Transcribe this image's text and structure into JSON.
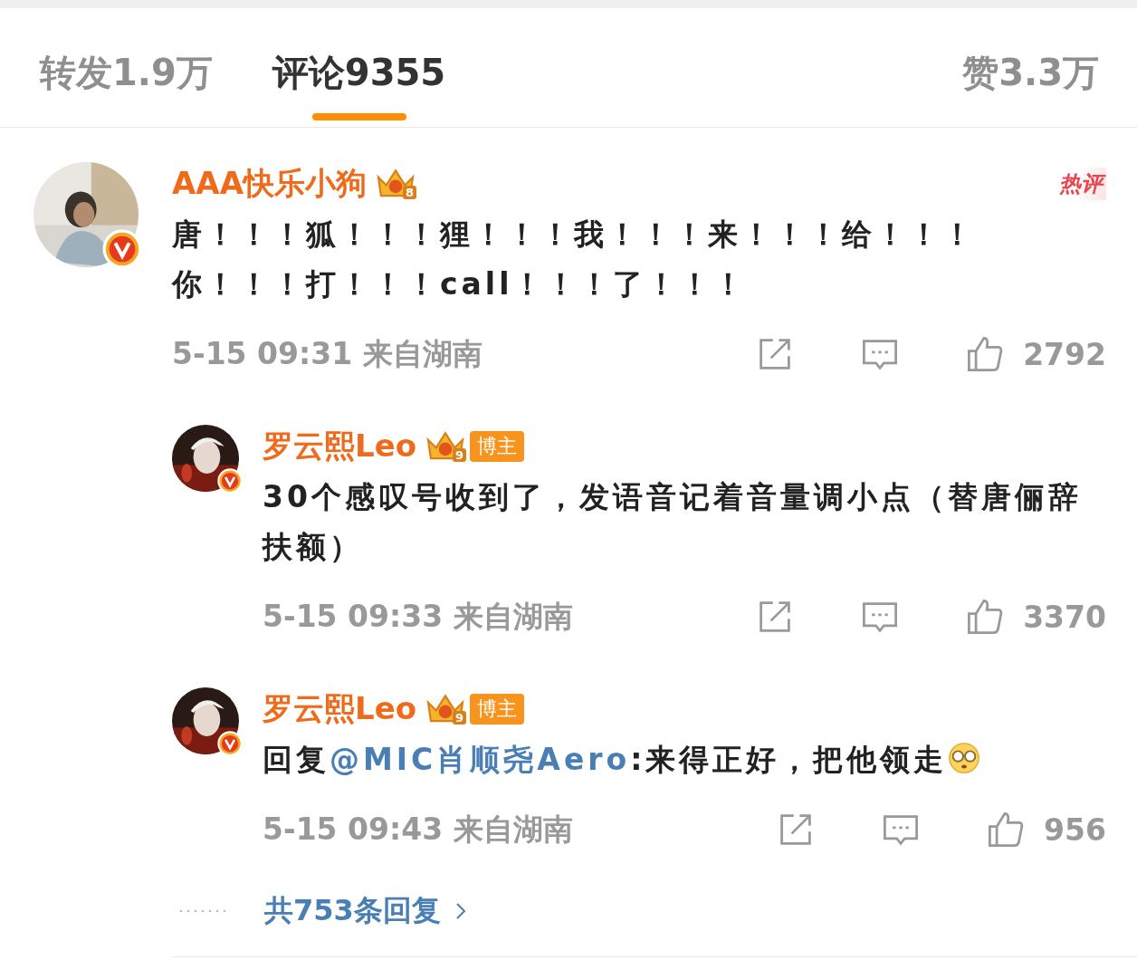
{
  "tabs": [
    {
      "label": "转发",
      "count": "1.9万",
      "selected": false
    },
    {
      "label": "评论",
      "count": "9355",
      "selected": true
    },
    {
      "label": "赞",
      "count": "3.3万",
      "selected": false
    }
  ],
  "comment": {
    "user": "AAA快乐小狗",
    "rank": "8",
    "tag": "热评",
    "verified": true,
    "parts": [
      {
        "kind": "text",
        "text": "唐！！！狐！！！狸！！！我！！！来！！！给！！！你！！！打！！！call！！！了！！！"
      }
    ],
    "time": "5-15 09:31",
    "location": "来自湖南",
    "likes": "2792",
    "replies": [
      {
        "user": "罗云熙Leo",
        "rank": "9",
        "role": "博主",
        "verified": true,
        "parts": [
          {
            "kind": "text",
            "text": "30个感叹号收到了，发语音记着音量调小点（替唐俪辞扶额）"
          }
        ],
        "time": "5-15 09:33",
        "location": "来自湖南",
        "likes": "3370"
      },
      {
        "user": "罗云熙Leo",
        "rank": "9",
        "role": "博主",
        "verified": true,
        "parts": [
          {
            "kind": "text",
            "text": "回复"
          },
          {
            "kind": "mention",
            "text": "@MIC肖顺尧Aero"
          },
          {
            "kind": "text",
            "text": ":来得正好，把他领走"
          },
          {
            "kind": "emoji"
          }
        ],
        "time": "5-15 09:43",
        "location": "来自湖南",
        "likes": "956"
      }
    ],
    "more_replies": "共753条回复"
  }
}
